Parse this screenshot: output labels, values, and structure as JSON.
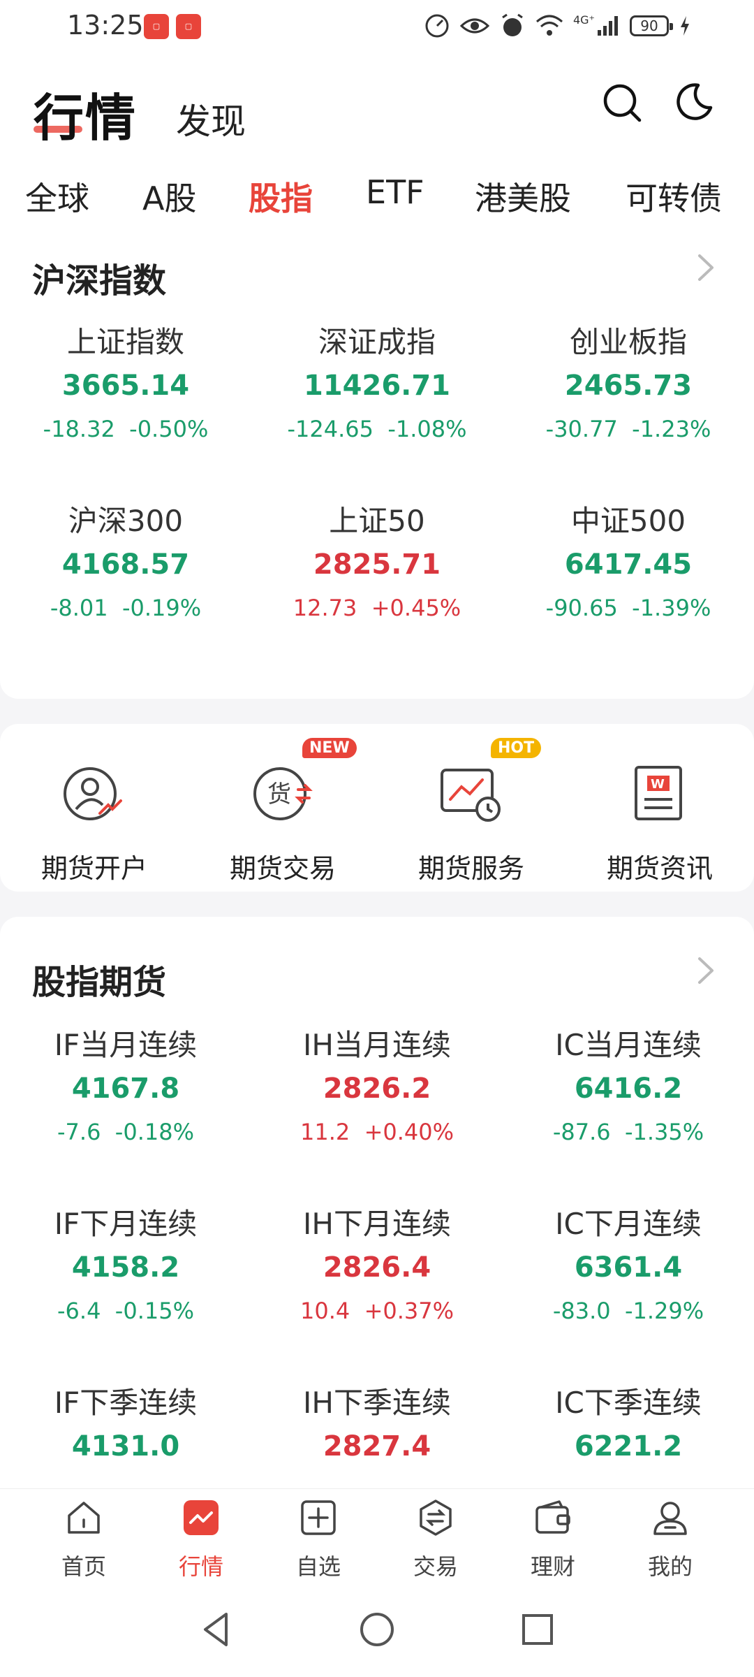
{
  "status_bar": {
    "time": "13:25",
    "signal_label": "4G⁺",
    "battery": "90"
  },
  "header": {
    "title": "行情",
    "discover": "发现"
  },
  "tabs": [
    {
      "label": "全球",
      "active": false
    },
    {
      "label": "A股",
      "active": false
    },
    {
      "label": "股指",
      "active": true
    },
    {
      "label": "ETF",
      "active": false
    },
    {
      "label": "港美股",
      "active": false
    },
    {
      "label": "可转债",
      "active": false
    }
  ],
  "indices": {
    "title": "沪深指数",
    "items": [
      {
        "name": "上证指数",
        "price": "3665.14",
        "change": "-18.32",
        "pct": "-0.50%",
        "trend": "down"
      },
      {
        "name": "深证成指",
        "price": "11426.71",
        "change": "-124.65",
        "pct": "-1.08%",
        "trend": "down"
      },
      {
        "name": "创业板指",
        "price": "2465.73",
        "change": "-30.77",
        "pct": "-1.23%",
        "trend": "down"
      },
      {
        "name": "沪深300",
        "price": "4168.57",
        "change": "-8.01",
        "pct": "-0.19%",
        "trend": "down"
      },
      {
        "name": "上证50",
        "price": "2825.71",
        "change": "12.73",
        "pct": "+0.45%",
        "trend": "up"
      },
      {
        "name": "中证500",
        "price": "6417.45",
        "change": "-90.65",
        "pct": "-1.39%",
        "trend": "down"
      }
    ]
  },
  "services": {
    "items": [
      {
        "label": "期货开户",
        "icon": "account-open-icon",
        "badge": ""
      },
      {
        "label": "期货交易",
        "icon": "trade-icon",
        "badge": "NEW"
      },
      {
        "label": "期货服务",
        "icon": "service-icon",
        "badge": "HOT"
      },
      {
        "label": "期货资讯",
        "icon": "news-icon",
        "badge": ""
      }
    ]
  },
  "futures": {
    "title": "股指期货",
    "items": [
      {
        "name": "IF当月连续",
        "price": "4167.8",
        "change": "-7.6",
        "pct": "-0.18%",
        "trend": "down"
      },
      {
        "name": "IH当月连续",
        "price": "2826.2",
        "change": "11.2",
        "pct": "+0.40%",
        "trend": "up"
      },
      {
        "name": "IC当月连续",
        "price": "6416.2",
        "change": "-87.6",
        "pct": "-1.35%",
        "trend": "down"
      },
      {
        "name": "IF下月连续",
        "price": "4158.2",
        "change": "-6.4",
        "pct": "-0.15%",
        "trend": "down"
      },
      {
        "name": "IH下月连续",
        "price": "2826.4",
        "change": "10.4",
        "pct": "+0.37%",
        "trend": "up"
      },
      {
        "name": "IC下月连续",
        "price": "6361.4",
        "change": "-83.0",
        "pct": "-1.29%",
        "trend": "down"
      },
      {
        "name": "IF下季连续",
        "price": "4131.0",
        "change": "",
        "pct": "",
        "trend": "down"
      },
      {
        "name": "IH下季连续",
        "price": "2827.4",
        "change": "",
        "pct": "",
        "trend": "up"
      },
      {
        "name": "IC下季连续",
        "price": "6221.2",
        "change": "",
        "pct": "",
        "trend": "down"
      }
    ]
  },
  "bottom_nav": [
    {
      "label": "首页",
      "icon": "home-icon",
      "active": false
    },
    {
      "label": "行情",
      "icon": "market-icon",
      "active": true
    },
    {
      "label": "自选",
      "icon": "watchlist-add-icon",
      "active": false
    },
    {
      "label": "交易",
      "icon": "exchange-icon",
      "active": false
    },
    {
      "label": "理财",
      "icon": "wallet-icon",
      "active": false
    },
    {
      "label": "我的",
      "icon": "profile-icon",
      "active": false
    }
  ],
  "colors": {
    "accent": "#e8443a",
    "up": "#d9363e",
    "down": "#1a9c6a",
    "hot": "#f4b400"
  }
}
